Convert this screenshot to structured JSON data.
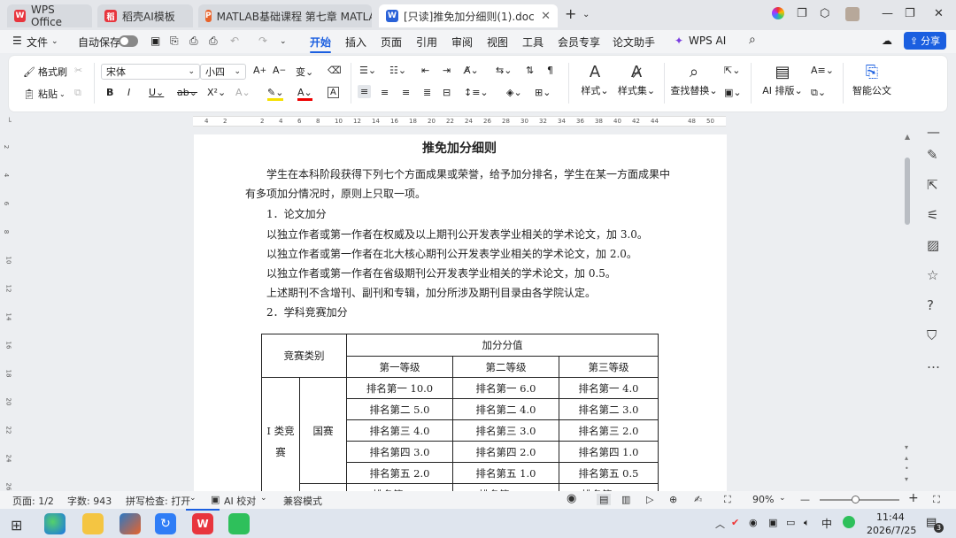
{
  "tabs": [
    {
      "label": "WPS Office"
    },
    {
      "label": "稻壳AI模板"
    },
    {
      "label": "MATLAB基础课程 第七章 MATLAB…"
    },
    {
      "label": "[只读]推免加分细则(1).doc"
    }
  ],
  "menu": {
    "file": "文件",
    "autosave": "自动保存",
    "items": [
      "开始",
      "插入",
      "页面",
      "引用",
      "审阅",
      "视图",
      "工具",
      "会员专享",
      "论文助手",
      "WPS AI"
    ],
    "share": "分享"
  },
  "ribbon": {
    "format_painter": "格式刷",
    "paste": "粘贴",
    "font_name": "宋体",
    "font_size": "小四",
    "style": "样式",
    "style_set": "样式集",
    "find_replace": "查找替换",
    "ai_layout": "AI 排版",
    "smart_doc": "智能公文"
  },
  "ruler": {
    "ticks": [
      "4",
      "2",
      "2",
      "4",
      "6",
      "8",
      "10",
      "12",
      "14",
      "16",
      "18",
      "20",
      "22",
      "24",
      "26",
      "28",
      "30",
      "32",
      "34",
      "36",
      "38",
      "40",
      "42",
      "44",
      "48",
      "50"
    ]
  },
  "vruler": {
    "ticks": [
      "2",
      "4",
      "6",
      "8",
      "10",
      "12",
      "14",
      "16",
      "18",
      "20",
      "22",
      "24",
      "26"
    ]
  },
  "doc": {
    "title": "推免加分细则",
    "intro1": "学生在本科阶段获得下列七个方面成果或荣誉，给予加分排名，学生在某一方面成果中",
    "intro2": "有多项加分情况时，原则上只取一项。",
    "sec1": "1．论文加分",
    "l1": "以独立作者或第一作者在权威及以上期刊公开发表学业相关的学术论文，加 3.0。",
    "l2": "以独立作者或第一作者在北大核心期刊公开发表学业相关的学术论文，加 2.0。",
    "l3": "以独立作者或第一作者在省级期刊公开发表学业相关的学术论文，加 0.5。",
    "l4": "上述期刊不含增刊、副刊和专辑，加分所涉及期刊目录由各学院认定。",
    "sec2": "2．学科竞赛加分",
    "table": {
      "h_category": "竞赛类别",
      "h_score": "加分分值",
      "levels": [
        "第一等级",
        "第二等级",
        "第三等级"
      ],
      "group": "I 类竞赛",
      "sub": "国赛",
      "rows": [
        [
          "排名第一 10.0",
          "排名第一 6.0",
          "排名第一 4.0"
        ],
        [
          "排名第二 5.0",
          "排名第二 4.0",
          "排名第二 3.0"
        ],
        [
          "排名第三 4.0",
          "排名第三 3.0",
          "排名第三 2.0"
        ],
        [
          "排名第四 3.0",
          "排名第四 2.0",
          "排名第四 1.0"
        ],
        [
          "排名第五 2.0",
          "排名第五 1.0",
          "排名第五 0.5"
        ],
        [
          "排名第一 …",
          "排名第一 …",
          "排名第一 …"
        ]
      ]
    }
  },
  "status": {
    "page": "页面: 1/2",
    "words": "字数: 943",
    "spell": "拼写检查: 打开",
    "ai_check": "AI 校对",
    "compat": "兼容模式",
    "zoom": "90%"
  },
  "taskbar": {
    "time": "11:44",
    "date": "2026/7/25",
    "ime": "中",
    "notif": "3"
  },
  "colors": {
    "accent": "#1b5fe0",
    "wps_red": "#e8353d",
    "matlab_orange": "#e8632a"
  }
}
